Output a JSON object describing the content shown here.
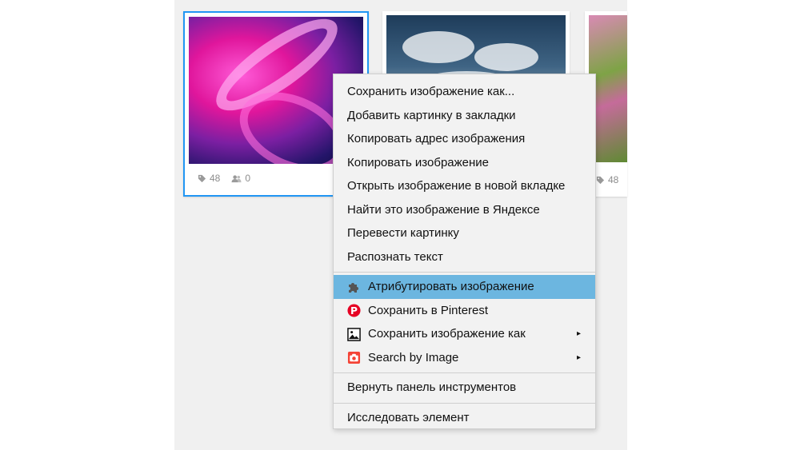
{
  "cards": [
    {
      "tags_count": "48",
      "people_count": "0",
      "selected": true
    },
    {
      "tags_count": "",
      "people_count": "",
      "selected": false
    },
    {
      "tags_count": "48",
      "people_count": "",
      "selected": false
    }
  ],
  "context_menu": {
    "items": [
      {
        "label": "Сохранить изображение как..."
      },
      {
        "label": "Добавить картинку в закладки"
      },
      {
        "label": "Копировать адрес изображения"
      },
      {
        "label": "Копировать изображение"
      },
      {
        "label": "Открыть изображение в новой вкладке"
      },
      {
        "label": "Найти это изображение в Яндексе"
      },
      {
        "label": "Перевести картинку"
      },
      {
        "label": "Распознать текст"
      }
    ],
    "extension_items": [
      {
        "label": "Атрибутировать изображение",
        "icon": "puzzle-icon",
        "highlighted": true
      },
      {
        "label": "Сохранить в Pinterest",
        "icon": "pinterest-icon"
      },
      {
        "label": "Сохранить изображение как",
        "icon": "image-icon",
        "has_submenu": true
      },
      {
        "label": "Search by Image",
        "icon": "camera-icon",
        "has_submenu": true
      }
    ],
    "toolbar_item": {
      "label": "Вернуть панель инструментов"
    },
    "inspect_item": {
      "label": "Исследовать элемент"
    },
    "submenu_arrow": "▸"
  },
  "colors": {
    "selection_border": "#2196f3",
    "menu_highlight": "#6cb6e0",
    "pinterest_red": "#e60023",
    "camera_red": "#f44336"
  }
}
